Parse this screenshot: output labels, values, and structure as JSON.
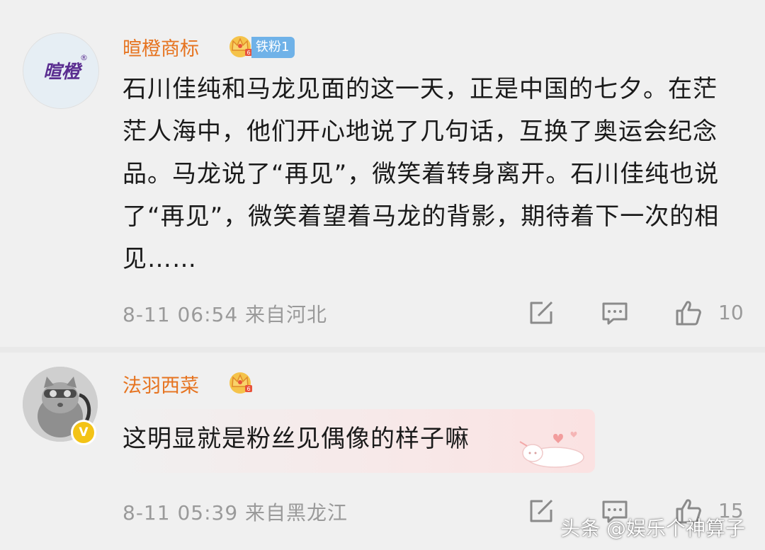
{
  "comments": [
    {
      "avatar_logo": "暄橙",
      "avatar_registered": "®",
      "username": "暄橙商标",
      "fan_badge": "铁粉1",
      "text": "石川佳纯和马龙见面的这一天，正是中国的七夕。在茫茫人海中，他们开心地说了几句话，互换了奥运会纪念品。马龙说了“再见”，微笑着转身离开。石川佳纯也说了“再见”，微笑着望着马龙的背影，期待着下一次的相见……",
      "meta": "8-11 06:54  来自河北",
      "likes": "10"
    },
    {
      "verified": "V",
      "username": "法羽西菜",
      "text": "这明显就是粉丝见偶像的样子嘛",
      "meta": "8-11 05:39  来自黑龙江",
      "likes": "15"
    }
  ],
  "icons": {
    "crown": "crown-icon",
    "share": "share-icon",
    "reply": "reply-icon",
    "like": "thumbs-up-icon"
  },
  "colors": {
    "username": "#e6731f",
    "fan_badge": "#6fb2e8",
    "meta": "#9a9a9a",
    "verified": "#f3c316"
  },
  "watermark": "头条 @娱乐个神算子"
}
